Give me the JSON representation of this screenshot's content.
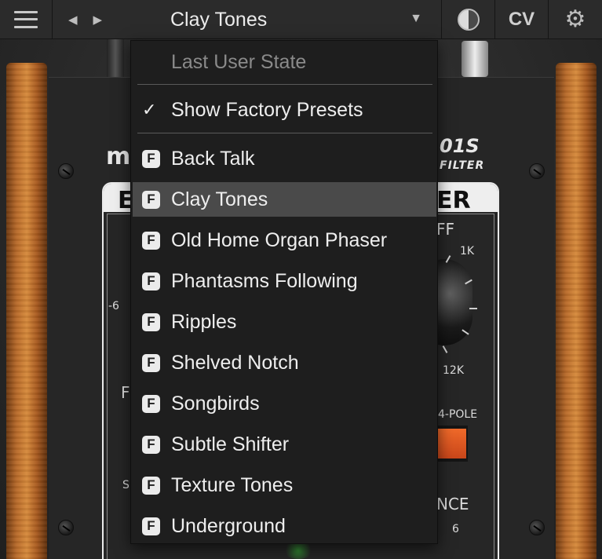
{
  "topbar": {
    "preset_name": "Clay Tones",
    "prev_glyph": "◀",
    "next_glyph": "▶",
    "caret_glyph": "▼",
    "cv_label": "CV",
    "settings_glyph": "⚙"
  },
  "dropdown": {
    "last_user_state": "Last User State",
    "show_factory_presets": "Show Factory Presets",
    "check_glyph": "✓",
    "factory_badge": "F",
    "selected_preset": "Clay Tones",
    "presets": [
      "Back Talk",
      "Clay Tones",
      "Old Home Organ Phaser",
      "Phantasms Following",
      "Ripples",
      "Shelved Notch",
      "Songbirds",
      "Subtle Shifter",
      "Texture Tones",
      "Underground"
    ]
  },
  "background": {
    "brand_partial": "m",
    "model_partial": "01S",
    "subtitle_partial": "FILTER",
    "left_heading_partial": "E",
    "right_heading_partial": "ER",
    "cutoff_partial": "FF",
    "tick_1k": "1K",
    "tick_12k": "12K",
    "tick_minus6": "-6",
    "label_f": "F",
    "label_s": "S",
    "pole_label": "4-POLE",
    "resonance_partial": "NCE",
    "tick_6": "6"
  },
  "colors": {
    "dropdown_bg": "#1e1e1e",
    "selected_bg": "#4a4a4a",
    "switch_orange": "#e0582a",
    "wood": "#c07a32"
  }
}
